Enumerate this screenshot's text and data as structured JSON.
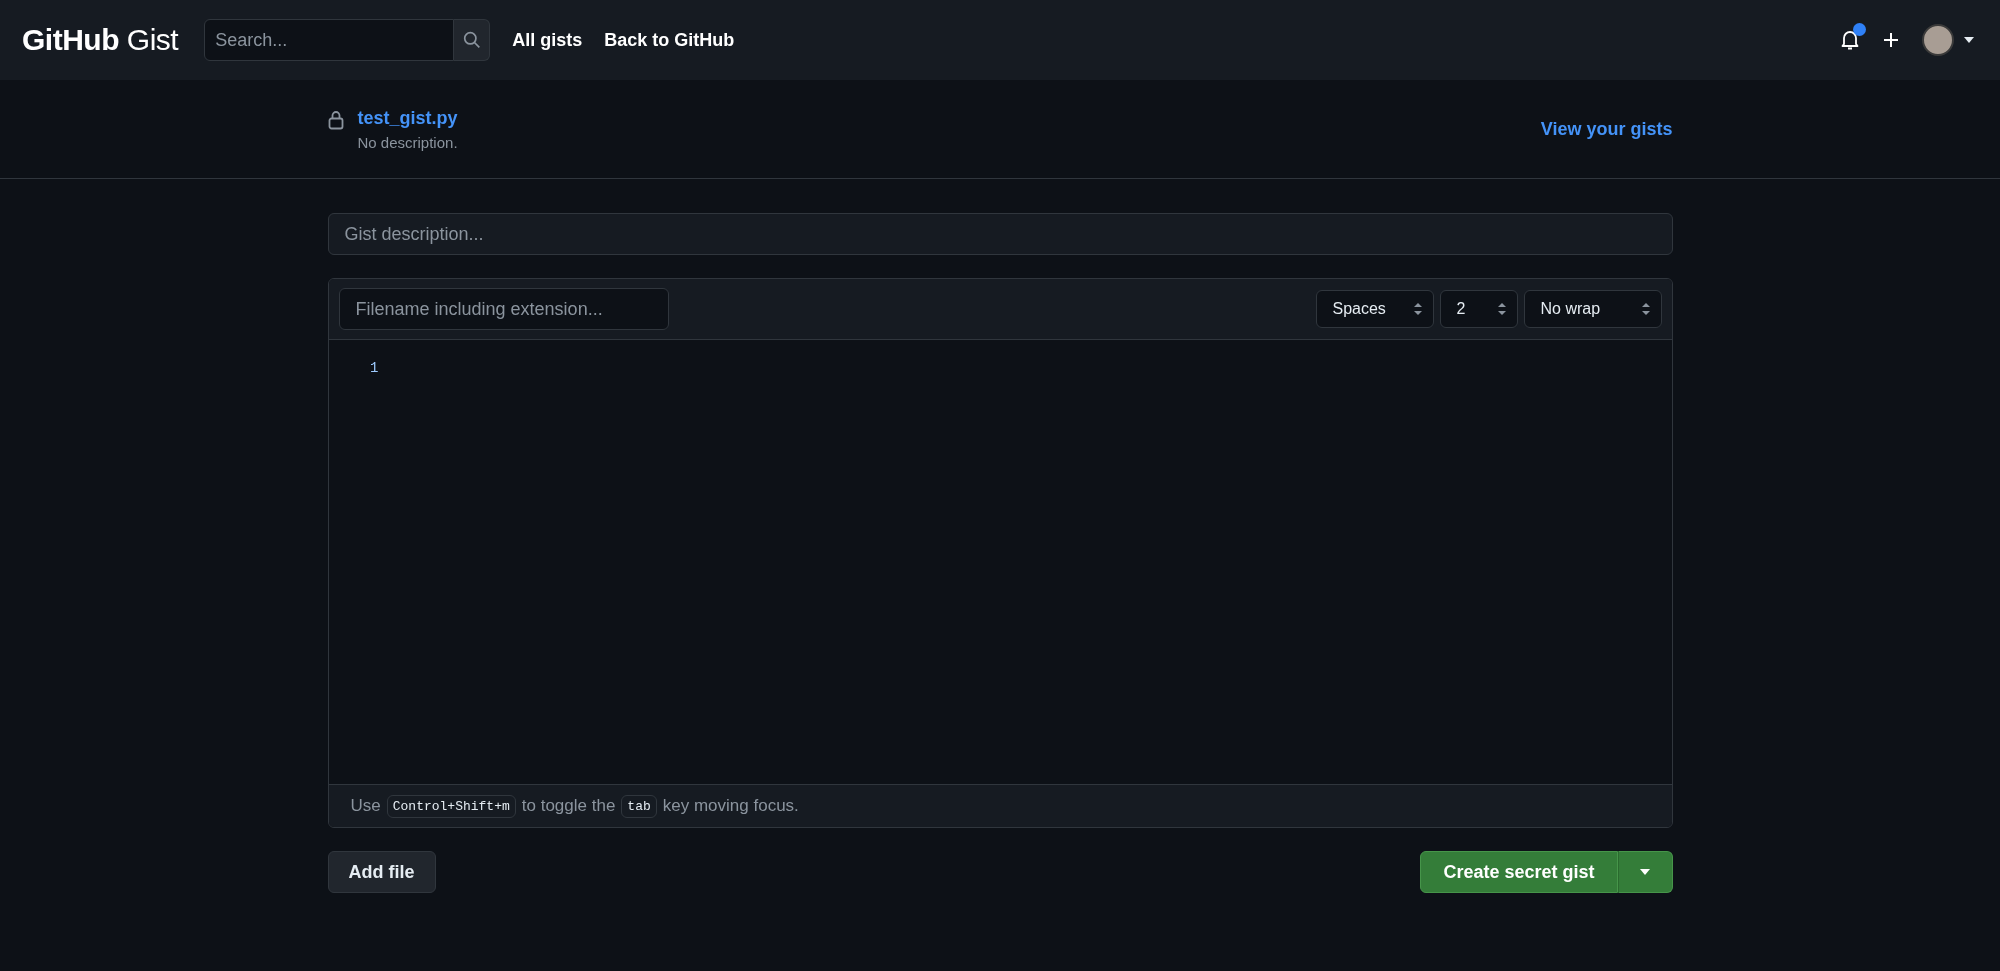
{
  "header": {
    "logo_bold": "GitHub",
    "logo_light": "Gist",
    "search": {
      "placeholder": "Search..."
    },
    "nav": [
      "All gists",
      "Back to GitHub"
    ],
    "notifications_unread": true
  },
  "gist": {
    "filename": "test_gist.py",
    "description": "No description.",
    "private": true,
    "view_link": "View your gists"
  },
  "description_field": {
    "placeholder": "Gist description..."
  },
  "file": {
    "filename_field": {
      "placeholder": "Filename including extension..."
    },
    "selects": [
      "Spaces",
      "2",
      "No wrap"
    ],
    "line_numbers": [
      "1"
    ],
    "hint": [
      {
        "kind": "text",
        "text": "Use"
      },
      {
        "kind": "key",
        "text": "Control+Shift+m"
      },
      {
        "kind": "text",
        "text": "to toggle the"
      },
      {
        "kind": "key",
        "text": "tab"
      },
      {
        "kind": "text",
        "text": "key moving focus."
      }
    ]
  },
  "buttons": {
    "add_file": "Add file",
    "create": "Create secret gist"
  }
}
